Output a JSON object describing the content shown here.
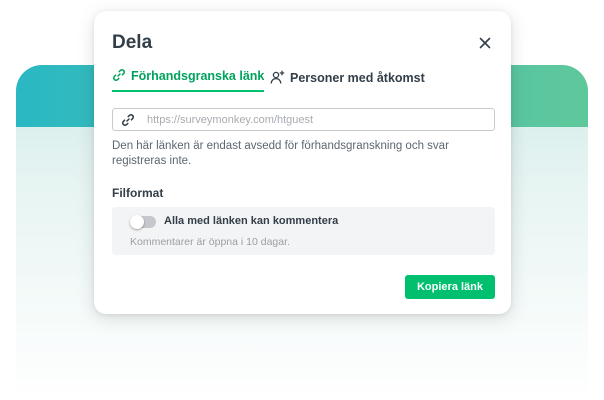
{
  "dialog": {
    "title": "Dela",
    "close_icon": "close-icon",
    "tabs": [
      {
        "label": "Förhandsgranska länk",
        "icon": "link-icon",
        "active": true
      },
      {
        "label": "Personer med åtkomst",
        "icon": "add-person-icon",
        "active": false
      }
    ],
    "link_field": {
      "placeholder": "https://surveymonkey.com/htguest",
      "icon": "link-icon"
    },
    "helper_text": "Den här länken är endast avsedd för förhandsgranskning och svar registreras inte.",
    "section_label": "Filformat",
    "comment_toggle": {
      "label": "Alla med länken kan kommentera",
      "enabled": false,
      "note": "Kommentarer är öppna i 10 dagar."
    },
    "copy_button": "Kopiera länk"
  },
  "colors": {
    "accent": "#00bf6f",
    "accent_text": "#00a35c",
    "text": "#333e48",
    "muted": "#9aa0a6",
    "backdrop_band_start": "#2ab8c2",
    "backdrop_band_end": "#5fc89b"
  }
}
